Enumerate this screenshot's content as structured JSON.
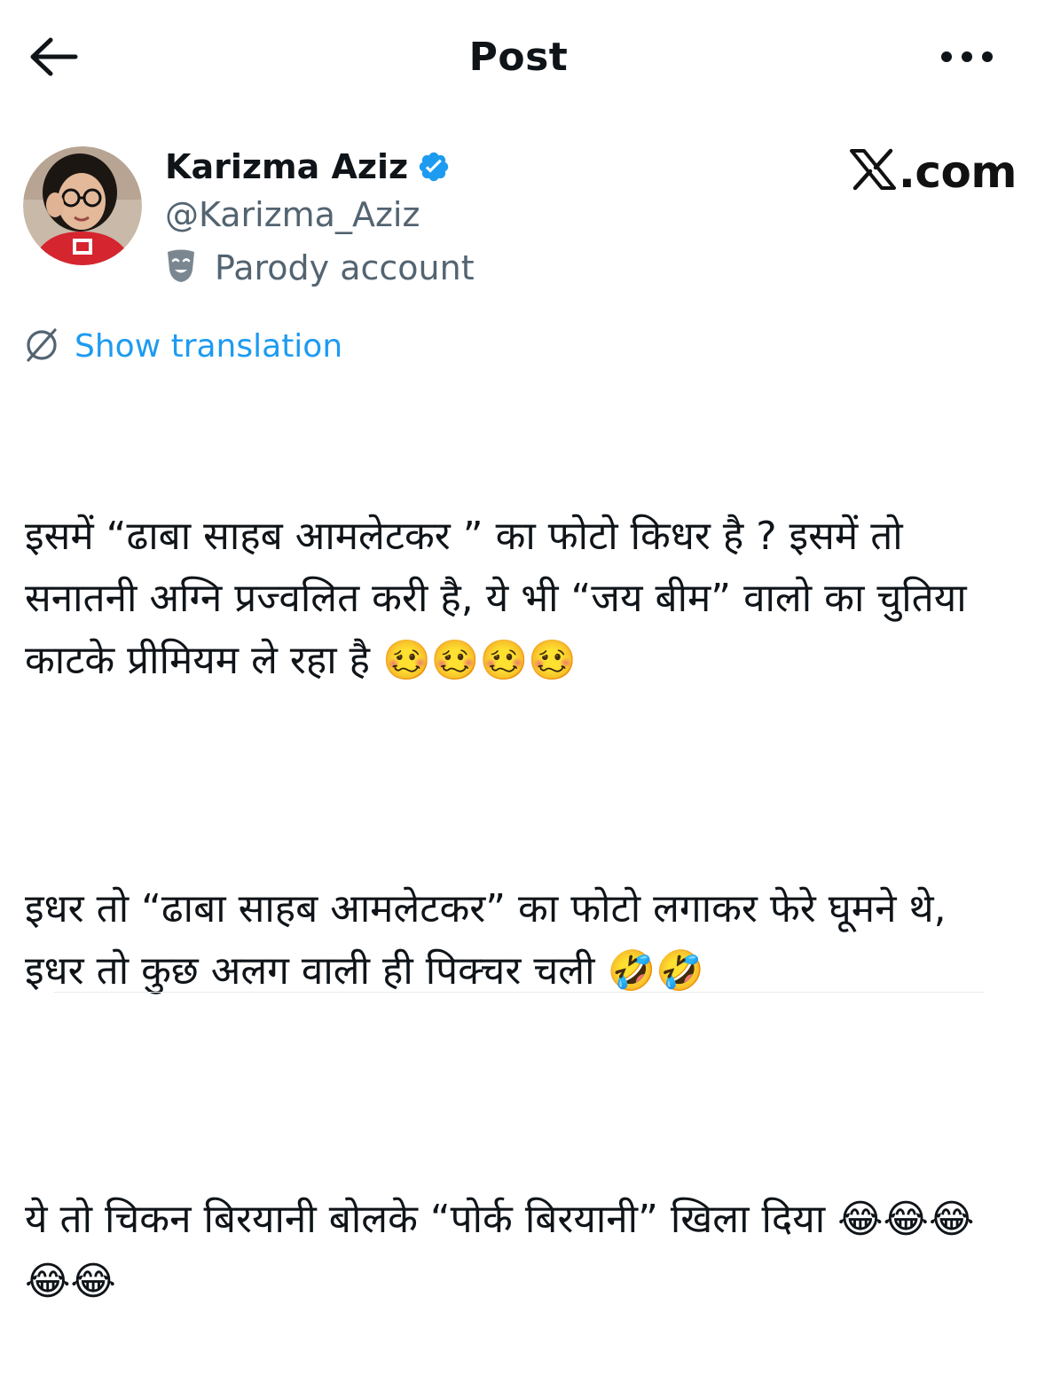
{
  "header": {
    "title": "Post",
    "back_icon": "arrow-left-icon",
    "more_icon": "more-horizontal-icon"
  },
  "author": {
    "name": "Karizma Aziz",
    "handle": "@Karizma_Aziz",
    "verified": true,
    "verified_color": "#1d9bf0",
    "parody_label": "Parody account",
    "parody_icon": "theater-mask-icon",
    "avatar_icon": "user-avatar"
  },
  "watermark": {
    "brand": "𝕏",
    "domain": ".com"
  },
  "translation": {
    "label": "Show translation",
    "icon": "translate-globe-icon",
    "color": "#1d9bf0"
  },
  "post": {
    "paragraphs": [
      "इसमें “ढाबा साहब आमलेटकर ” का फोटो किधर है ? इसमें तो सनातनी अग्नि प्रज्वलित करी है, ये भी “जय बीम” वालो का चुतिया काटके प्रीमियम ले रहा है 🥴🥴🥴🥴",
      "इधर तो “ढाबा साहब आमलेटकर” का फोटो लगाकर फेरे घूमने थे, इधर तो कुछ अलग वाली ही पिक्चर चली 🤣🤣",
      "ये तो चिकन बिरयानी बोलके “पोर्क बिरयानी” खिला दिया 😂😂😂😂😂"
    ]
  },
  "colors": {
    "text_primary": "#0f1419",
    "text_secondary": "#536471",
    "link": "#1d9bf0"
  }
}
